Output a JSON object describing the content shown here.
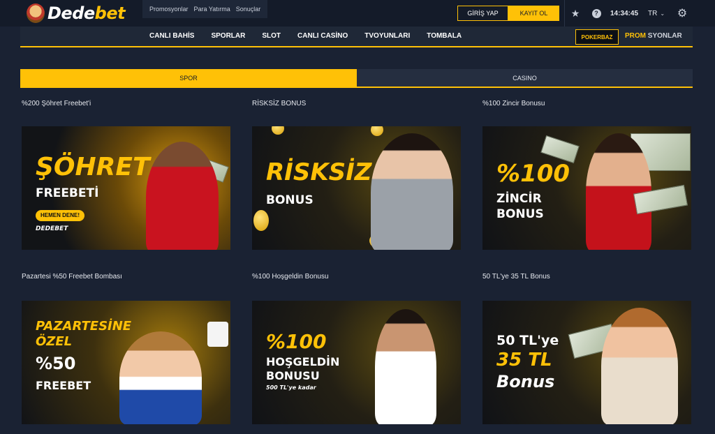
{
  "brand": {
    "name_part1": "Dede",
    "name_part2": "bet"
  },
  "toplinks": [
    "Promosyonlar",
    "Para Yatırma",
    "Sonuçlar"
  ],
  "auth": {
    "login": "GİRİŞ YAP",
    "register": "KAYIT OL"
  },
  "header": {
    "time": "14:34:45",
    "language": "TR"
  },
  "nav": [
    "CANLI BAHİS",
    "SPORLAR",
    "SLOT",
    "CANLI CASİNO",
    "TVOYUNLARI",
    "TOMBALA"
  ],
  "pokerbaz": "POKERBAZ",
  "promo": {
    "part1": "PROM",
    "part2": "SYONLAR"
  },
  "tabs": {
    "spor": "SPOR",
    "casino": "CASINO"
  },
  "cards": [
    {
      "title": "%200 Şöhret Freebet'i",
      "lines": [
        "ŞÖHRET",
        "FREEBETİ"
      ],
      "cta": "HEMEN DENE!",
      "brand": "DEDEBET"
    },
    {
      "title": "RİSKSİZ BONUS",
      "lines": [
        "RİSKSİZ",
        "BONUS"
      ]
    },
    {
      "title": "%100 Zincir Bonusu",
      "lines": [
        "%100",
        "ZİNCİR",
        "BONUS"
      ]
    },
    {
      "title": "Pazartesi %50 Freebet Bombası",
      "lines": [
        "PAZARTESİNE",
        "ÖZEL",
        "%50",
        "FREEBET"
      ]
    },
    {
      "title": "%100 Hoşgeldin Bonusu",
      "lines": [
        "%100",
        "HOŞGELDİN",
        "BONUSU"
      ],
      "note": "500 TL'ye kadar"
    },
    {
      "title": "50 TL'ye 35 TL Bonus",
      "lines": [
        "50 TL'ye",
        "35 TL",
        "Bonus"
      ]
    }
  ],
  "colors": {
    "accent": "#ffc107",
    "background": "#1a2233",
    "topbar": "#141b29"
  },
  "icons": [
    "star-icon",
    "help-icon",
    "chevron-down-icon",
    "gear-icon"
  ]
}
